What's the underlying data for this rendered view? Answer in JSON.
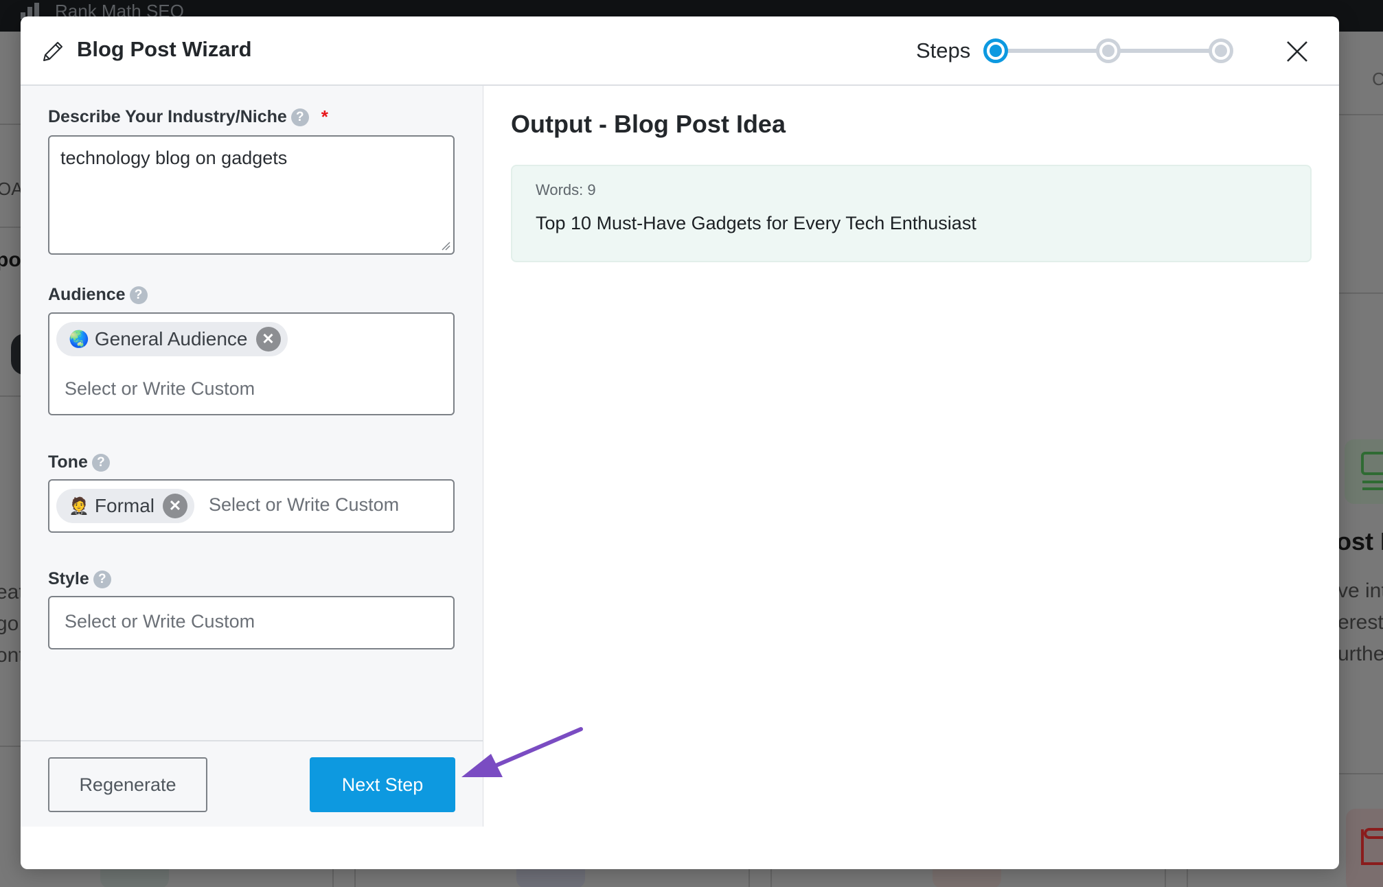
{
  "background": {
    "app_title": "Rank Math SEO",
    "fragments": {
      "left_top": "OA",
      "left_bold": "po",
      "left_line1": "eat",
      "left_line2": "go.",
      "left_line3": "ont",
      "right_top": "C",
      "right_heading": "ost In",
      "right_line1": "ve int",
      "right_line2": "erest,",
      "right_line3": "urthe"
    }
  },
  "modal": {
    "title": "Blog Post Wizard",
    "steps_label": "Steps",
    "steps": [
      {
        "index": 1,
        "state": "active"
      },
      {
        "index": 2,
        "state": "inactive"
      },
      {
        "index": 3,
        "state": "inactive"
      }
    ],
    "form": {
      "niche": {
        "label": "Describe Your Industry/Niche",
        "help": "?",
        "required_mark": "*",
        "value": "technology blog on gadgets"
      },
      "audience": {
        "label": "Audience",
        "help": "?",
        "chips": [
          {
            "emoji": "🌏",
            "label": "General Audience",
            "remove": "✕"
          }
        ],
        "placeholder": "Select or Write Custom"
      },
      "tone": {
        "label": "Tone",
        "help": "?",
        "chips": [
          {
            "emoji": "🤵",
            "label": "Formal",
            "remove": "✕"
          }
        ],
        "placeholder": "Select or Write Custom"
      },
      "style": {
        "label": "Style",
        "help": "?",
        "placeholder": "Select or Write Custom"
      }
    },
    "buttons": {
      "regenerate": "Regenerate",
      "next_step": "Next Step"
    },
    "output": {
      "title": "Output - Blog Post Idea",
      "word_count": "Words: 9",
      "text": "Top 10 Must-Have Gadgets for Every Tech Enthusiast"
    }
  },
  "colors": {
    "accent": "#0d99e0",
    "required": "#e8161b",
    "output_bg": "#eef7f4",
    "annotation_arrow": "#7a4cc2"
  }
}
